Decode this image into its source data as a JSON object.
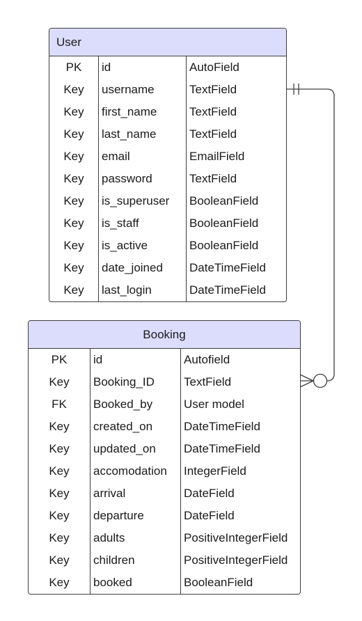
{
  "entities": {
    "user": {
      "title": "User",
      "rows": [
        {
          "key": "PK",
          "field": "id",
          "type": "AutoField"
        },
        {
          "key": "Key",
          "field": "username",
          "type": "TextField"
        },
        {
          "key": "Key",
          "field": "first_name",
          "type": "TextField"
        },
        {
          "key": "Key",
          "field": "last_name",
          "type": "TextField"
        },
        {
          "key": "Key",
          "field": "email",
          "type": "EmailField"
        },
        {
          "key": "Key",
          "field": "password",
          "type": "TextField"
        },
        {
          "key": "Key",
          "field": "is_superuser",
          "type": "BooleanField"
        },
        {
          "key": "Key",
          "field": "is_staff",
          "type": "BooleanField"
        },
        {
          "key": "Key",
          "field": "is_active",
          "type": "BooleanField"
        },
        {
          "key": "Key",
          "field": "date_joined",
          "type": "DateTimeField"
        },
        {
          "key": "Key",
          "field": "last_login",
          "type": "DateTimeField"
        }
      ]
    },
    "booking": {
      "title": "Booking",
      "rows": [
        {
          "key": "PK",
          "field": "id",
          "type": "Autofield"
        },
        {
          "key": "Key",
          "field": "Booking_ID",
          "type": "TextField"
        },
        {
          "key": "FK",
          "field": "Booked_by",
          "type": "User model"
        },
        {
          "key": "Key",
          "field": "created_on",
          "type": "DateTimeField"
        },
        {
          "key": "Key",
          "field": "updated_on",
          "type": "DateTimeField"
        },
        {
          "key": "Key",
          "field": "accomodation",
          "type": "IntegerField"
        },
        {
          "key": "Key",
          "field": "arrival",
          "type": "DateField"
        },
        {
          "key": "Key",
          "field": "departure",
          "type": "DateField"
        },
        {
          "key": "Key",
          "field": "adults",
          "type": "PositiveIntegerField"
        },
        {
          "key": "Key",
          "field": "children",
          "type": "PositiveIntegerField"
        },
        {
          "key": "Key",
          "field": "booked",
          "type": "BooleanField"
        }
      ]
    }
  },
  "relationship": {
    "from_cardinality": "one-and-only-one",
    "to_cardinality": "zero-or-many"
  },
  "colors": {
    "header_fill": "#dcdcfd",
    "border": "#3d3d3d",
    "text": "#1a1a1a"
  }
}
